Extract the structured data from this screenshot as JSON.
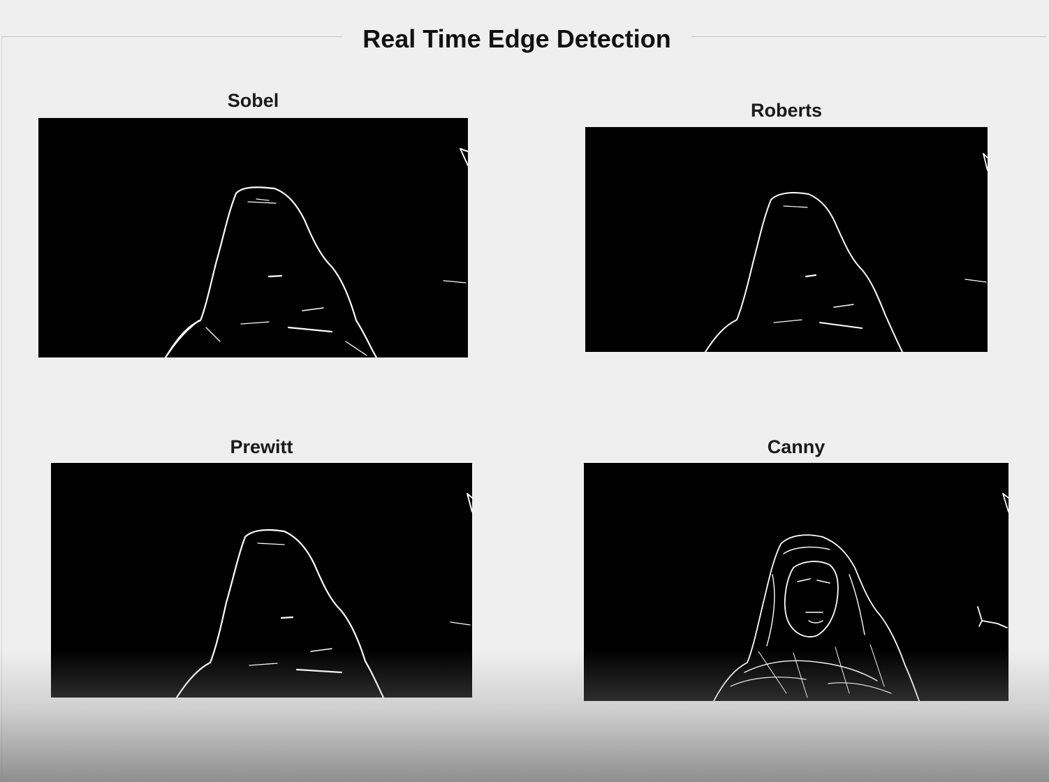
{
  "panel": {
    "title": "Real Time Edge Detection"
  },
  "axes": [
    {
      "id": "sobel",
      "title": "Sobel"
    },
    {
      "id": "roberts",
      "title": "Roberts"
    },
    {
      "id": "prewitt",
      "title": "Prewitt"
    },
    {
      "id": "canny",
      "title": "Canny"
    }
  ],
  "colors": {
    "background": "#efefef",
    "image_bg": "#000000",
    "edge": "#ffffff"
  }
}
